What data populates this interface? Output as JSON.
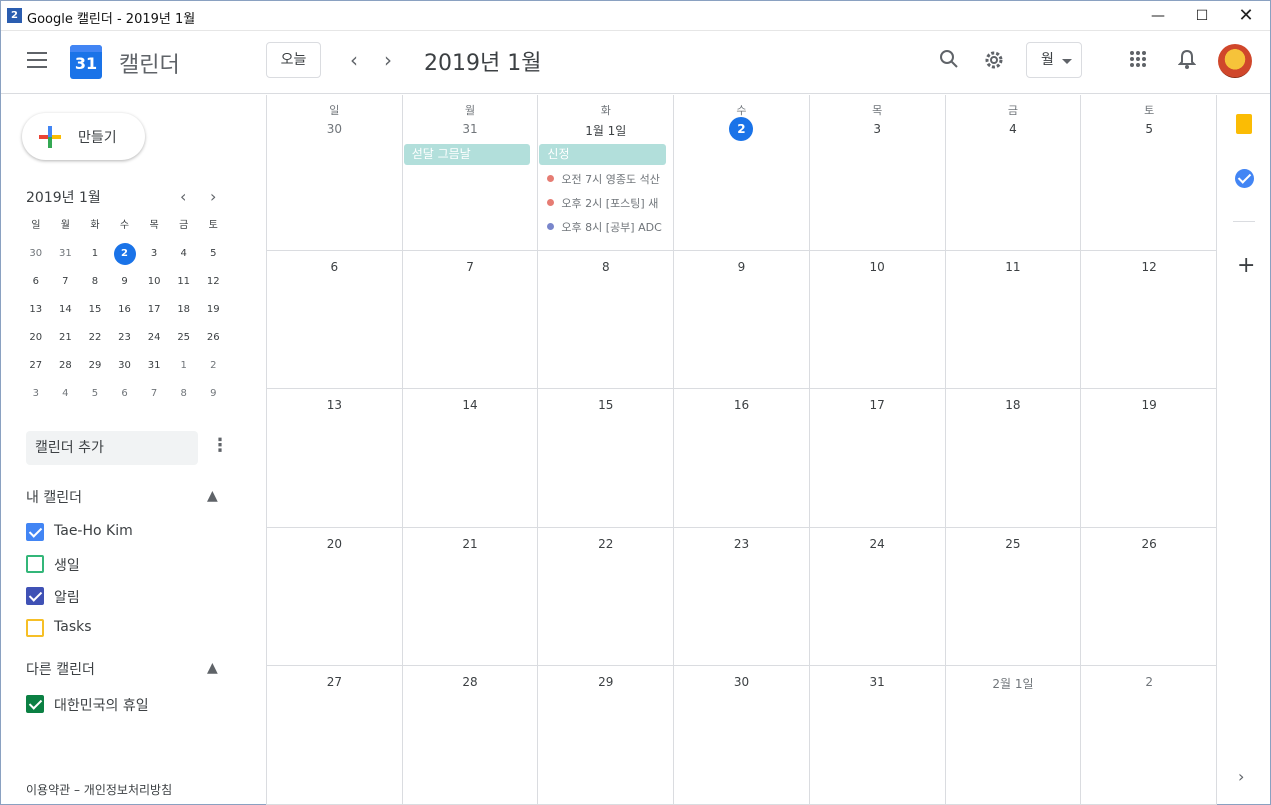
{
  "window": {
    "title": "Google 캘린더 - 2019년 1월",
    "icon_text": "2",
    "controls": [
      "minimize-icon",
      "maximize-icon",
      "close-icon"
    ]
  },
  "header": {
    "app_name": "캘린더",
    "logo_day": "31",
    "today_label": "오늘",
    "current_period": "2019년 1월",
    "view_label": "월",
    "icons": [
      "menu-icon",
      "search-icon",
      "settings-icon",
      "apps-icon",
      "notifications-icon"
    ]
  },
  "sidebar": {
    "create_label": "만들기",
    "mini_calendar": {
      "title": "2019년 1월",
      "weekdays": [
        "일",
        "월",
        "화",
        "수",
        "목",
        "금",
        "토"
      ],
      "weeks": [
        [
          "30",
          "31",
          "1",
          "2",
          "3",
          "4",
          "5"
        ],
        [
          "6",
          "7",
          "8",
          "9",
          "10",
          "11",
          "12"
        ],
        [
          "13",
          "14",
          "15",
          "16",
          "17",
          "18",
          "19"
        ],
        [
          "20",
          "21",
          "22",
          "23",
          "24",
          "25",
          "26"
        ],
        [
          "27",
          "28",
          "29",
          "30",
          "31",
          "1",
          "2"
        ],
        [
          "3",
          "4",
          "5",
          "6",
          "7",
          "8",
          "9"
        ]
      ],
      "today": "2"
    },
    "add_calendar_placeholder": "캘린더 추가",
    "my_calendars_title": "내 캘린더",
    "my_calendars": [
      {
        "label": "Tae-Ho Kim",
        "checked": true,
        "color": "#4285f4"
      },
      {
        "label": "생일",
        "checked": false,
        "color": "#33b679"
      },
      {
        "label": "알림",
        "checked": true,
        "color": "#3f51b5"
      },
      {
        "label": "Tasks",
        "checked": false,
        "color": "#f6bf26"
      }
    ],
    "other_calendars_title": "다른 캘린더",
    "other_calendars": [
      {
        "label": "대한민국의 휴일",
        "checked": true,
        "color": "#0b8043"
      }
    ],
    "footer": "이용약관 – 개인정보처리방침"
  },
  "month_grid": {
    "weekdays": [
      "일",
      "월",
      "화",
      "수",
      "목",
      "금",
      "토"
    ],
    "weeks": [
      [
        "30",
        "31",
        "1월 1일",
        "2",
        "3",
        "4",
        "5"
      ],
      [
        "6",
        "7",
        "8",
        "9",
        "10",
        "11",
        "12"
      ],
      [
        "13",
        "14",
        "15",
        "16",
        "17",
        "18",
        "19"
      ],
      [
        "20",
        "21",
        "22",
        "23",
        "24",
        "25",
        "26"
      ],
      [
        "27",
        "28",
        "29",
        "30",
        "31",
        "2월 1일",
        "2"
      ]
    ],
    "today": "2",
    "events": {
      "holiday_bar_1": "섣달 그믐날",
      "holiday_bar_2": "신정",
      "items": [
        {
          "text": "오전 7시 영종도 석산",
          "color": "#e67c73"
        },
        {
          "text": "오후 2시 [포스팅] 새",
          "color": "#e67c73"
        },
        {
          "text": "오후 8시 [공부] ADC",
          "color": "#7986cb"
        }
      ]
    }
  },
  "rail": {
    "icons": [
      "keep-icon",
      "tasks-icon",
      "add-icon",
      "expand-icon"
    ]
  }
}
